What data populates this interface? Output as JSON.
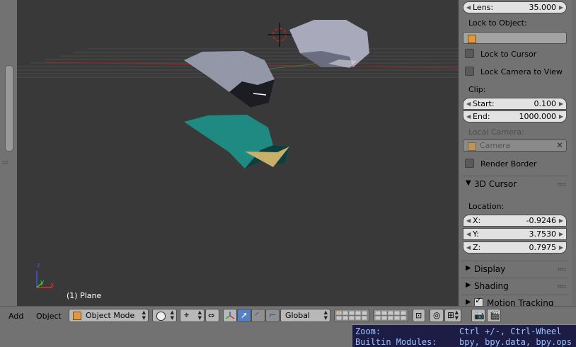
{
  "viewport": {
    "object_label": "(1) Plane",
    "axis_x": "x",
    "axis_y": "y",
    "axis_z": "z"
  },
  "view_panel": {
    "lens": {
      "label": "Lens:",
      "value": "35.000"
    },
    "lock_to_object_label": "Lock to Object:",
    "lock_to_cursor": {
      "label": "Lock to Cursor",
      "checked": false
    },
    "lock_camera_to_view": {
      "label": "Lock Camera to View",
      "checked": false
    },
    "clip_label": "Clip:",
    "clip_start": {
      "label": "Start:",
      "value": "0.100"
    },
    "clip_end": {
      "label": "End:",
      "value": "1000.000"
    },
    "local_camera_label": "Local Camera:",
    "local_camera_value": "Camera",
    "render_border": {
      "label": "Render Border",
      "checked": false
    }
  },
  "cursor_panel": {
    "title": "3D Cursor",
    "location_label": "Location:",
    "x": {
      "label": "X:",
      "value": "-0.9246"
    },
    "y": {
      "label": "Y:",
      "value": "3.7530"
    },
    "z": {
      "label": "Z:",
      "value": "0.7975"
    }
  },
  "collapsed_panels": {
    "display": "Display",
    "shading": "Shading",
    "motion_tracking": "Motion Tracking"
  },
  "header": {
    "add": "Add",
    "object": "Object",
    "mode": "Object Mode",
    "orientation": "Global"
  },
  "console": {
    "line1_left": "Zoom:",
    "line1_right": "Ctrl +/-, Ctrl-Wheel",
    "line2_left": "Builtin Modules:",
    "line2_right": "bpy, bpy.data, bpy.ops"
  },
  "colors": {
    "panel_bg": "#727272",
    "viewport_bg": "#393939",
    "field_bg": "#e2e2e2",
    "active_button": "#5680c2",
    "console_bg": "#1c1c45",
    "console_text": "#9cc4ff"
  }
}
